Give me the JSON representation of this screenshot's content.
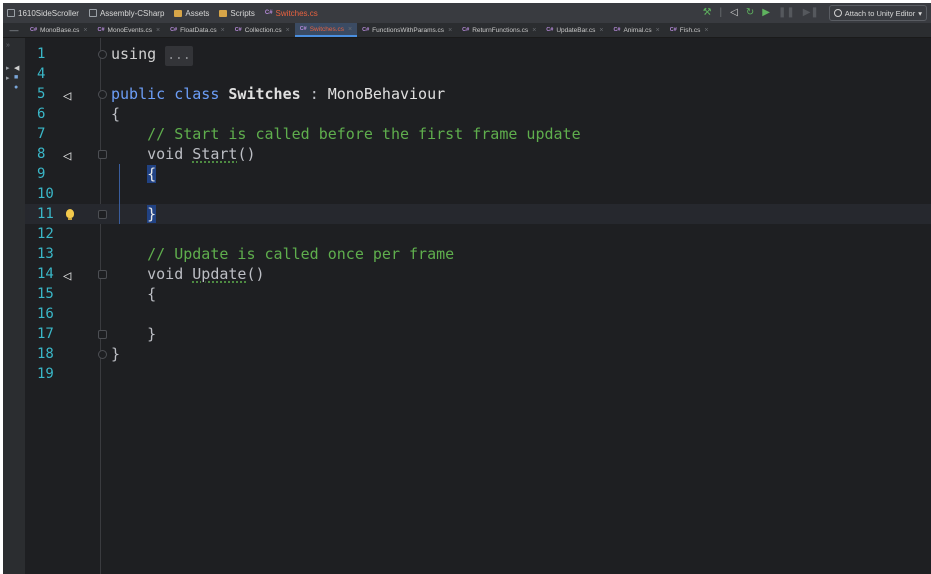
{
  "navbar": {
    "crumbs": [
      {
        "label": "1610SideScroller",
        "icon": "project-icon"
      },
      {
        "label": "Assembly-CSharp",
        "icon": "assembly-icon"
      },
      {
        "label": "Assets",
        "icon": "folder-icon"
      },
      {
        "label": "Scripts",
        "icon": "folder-icon"
      },
      {
        "cs": "C#",
        "label": "Switches.cs",
        "icon": "csharp-file-icon"
      }
    ],
    "attach_label": "Attach to Unity Editor",
    "more": "▾"
  },
  "tabs": [
    {
      "cs": "C#",
      "name": "MonoBase.cs",
      "close": "×"
    },
    {
      "cs": "C#",
      "name": "MonoEvents.cs",
      "close": "×"
    },
    {
      "cs": "C#",
      "name": "FloatData.cs",
      "close": "×"
    },
    {
      "cs": "C#",
      "name": "Collection.cs",
      "close": "×"
    },
    {
      "cs": "C#",
      "name": "Switches.cs",
      "close": "×"
    },
    {
      "cs": "C#",
      "name": "FunctionsWithParams.cs",
      "close": "×"
    },
    {
      "cs": "C#",
      "name": "ReturnFunctions.cs",
      "close": "×"
    },
    {
      "cs": "C#",
      "name": "UpdateBar.cs",
      "close": "×"
    },
    {
      "cs": "C#",
      "name": "Animal.cs",
      "close": "×"
    },
    {
      "cs": "C#",
      "name": "Fish.cs",
      "close": "×"
    }
  ],
  "editor": {
    "line_numbers": [
      "1",
      "4",
      "5",
      "6",
      "7",
      "8",
      "9",
      "10",
      "11",
      "12",
      "13",
      "14",
      "15",
      "16",
      "17",
      "18",
      "19"
    ],
    "using_kw": "using",
    "collapsed": "...",
    "public_kw": "public",
    "class_kw": "class",
    "class_name": "Switches",
    "colon": ":",
    "base_class": "MonoBehaviour",
    "open_brace": "{",
    "close_brace": "}",
    "comment_start": "// Start is called before the first frame update",
    "void_kw": "void",
    "start_name": "Start",
    "parens": "()",
    "comment_update": "// Update is called once per frame",
    "update_name": "Update"
  },
  "colors": {
    "keyword": "#6c9ef8",
    "comment": "#5fae4d",
    "line_number": "#3ab7c8",
    "active_tab_text": "#e8623f"
  }
}
